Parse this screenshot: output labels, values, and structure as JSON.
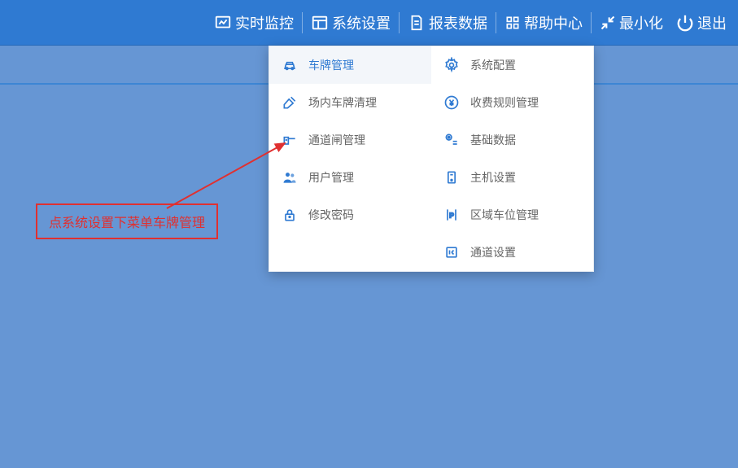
{
  "topnav": {
    "monitor": "实时监控",
    "settings": "系统设置",
    "reports": "报表数据",
    "help": "帮助中心",
    "minimize": "最小化",
    "exit": "退出"
  },
  "dropdown": {
    "left": [
      {
        "label": "车牌管理"
      },
      {
        "label": "场内车牌清理"
      },
      {
        "label": "通道闸管理"
      },
      {
        "label": "用户管理"
      },
      {
        "label": "修改密码"
      }
    ],
    "right": [
      {
        "label": "系统配置"
      },
      {
        "label": "收费规则管理"
      },
      {
        "label": "基础数据"
      },
      {
        "label": "主机设置"
      },
      {
        "label": "区域车位管理"
      },
      {
        "label": "通道设置"
      }
    ]
  },
  "annotation": {
    "text": "点系统设置下菜单车牌管理"
  }
}
